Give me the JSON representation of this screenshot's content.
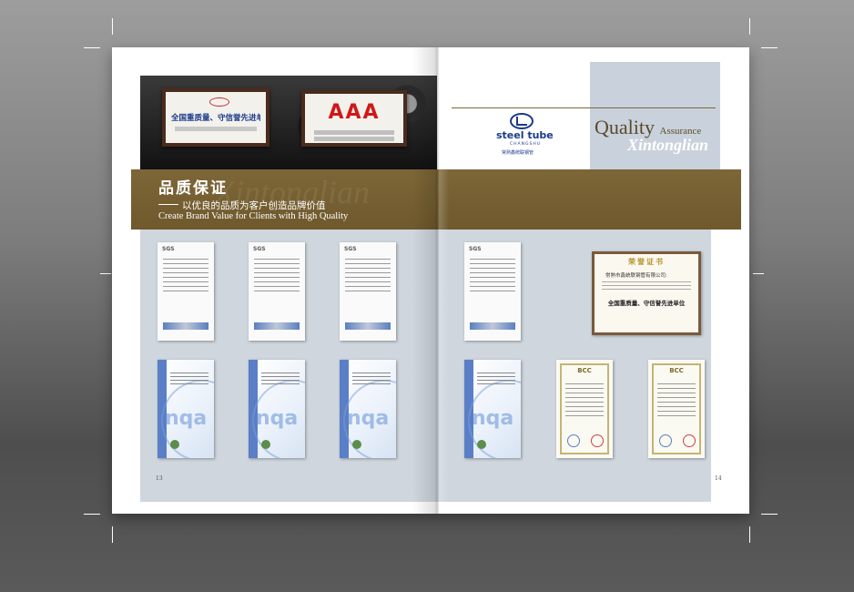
{
  "left_page": {
    "banner_title": "品质保证",
    "banner_subtitle_zh": "以优良的品质为客户创造品牌价值",
    "banner_subtitle_en": "Create Brand Value for Clients with High Quality",
    "banner_watermark": "Xintonglian",
    "plaque1_title": "全国重质量、守信誉先进单位",
    "plaque2_title": "AAA",
    "sgs_label": "SGS",
    "nqa_label": "nqa",
    "page_number": "13"
  },
  "right_page": {
    "brand_name": "steel tube",
    "brand_sub": "CHANGSHU",
    "brand_zh": "常熟鑫统联钢管",
    "qa_title": "Quality",
    "qa_assurance": "Assurance",
    "qa_brand": "Xintonglian",
    "honor_head": "荣誉证书",
    "honor_org": "常熟市鑫统联钢管有限公司:",
    "honor_title": "全国重质量、守信誉先进单位",
    "sgs_label": "SGS",
    "nqa_label": "nqa",
    "bcc_label": "BCC",
    "page_number": "14"
  },
  "colors": {
    "banner_gold": "#7d6637",
    "panel_blue": "#cfd6de",
    "brand_blue": "#1b3a8a"
  }
}
